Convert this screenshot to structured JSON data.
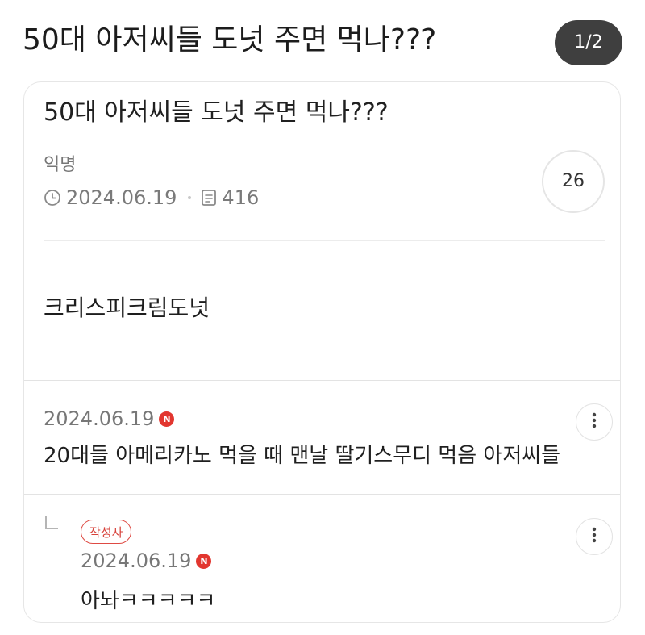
{
  "header": {
    "title": "50대 아저씨들 도넛 주면 먹나???",
    "page_counter": "1/2"
  },
  "post": {
    "title": "50대 아저씨들 도넛 주면 먹나???",
    "author": "익명",
    "date": "2024.06.19",
    "views": "416",
    "comment_count": "26",
    "body": "크리스피크림도넛"
  },
  "comments": [
    {
      "date": "2024.06.19",
      "new_badge": "N",
      "text": "20대들 아메리카노 먹을 때 맨날 딸기스무디 먹음 아저씨들"
    }
  ],
  "replies": [
    {
      "author_tag": "작성자",
      "date": "2024.06.19",
      "new_badge": "N",
      "text": "아놔ㅋㅋㅋㅋㅋ"
    }
  ],
  "icons": {
    "date": "clock-icon",
    "views": "document-list-icon",
    "more": "more-vertical-icon",
    "reply": "reply-arrow-icon"
  },
  "colors": {
    "accent_red": "#e2362f",
    "counter_bg": "#3f3f3f"
  }
}
